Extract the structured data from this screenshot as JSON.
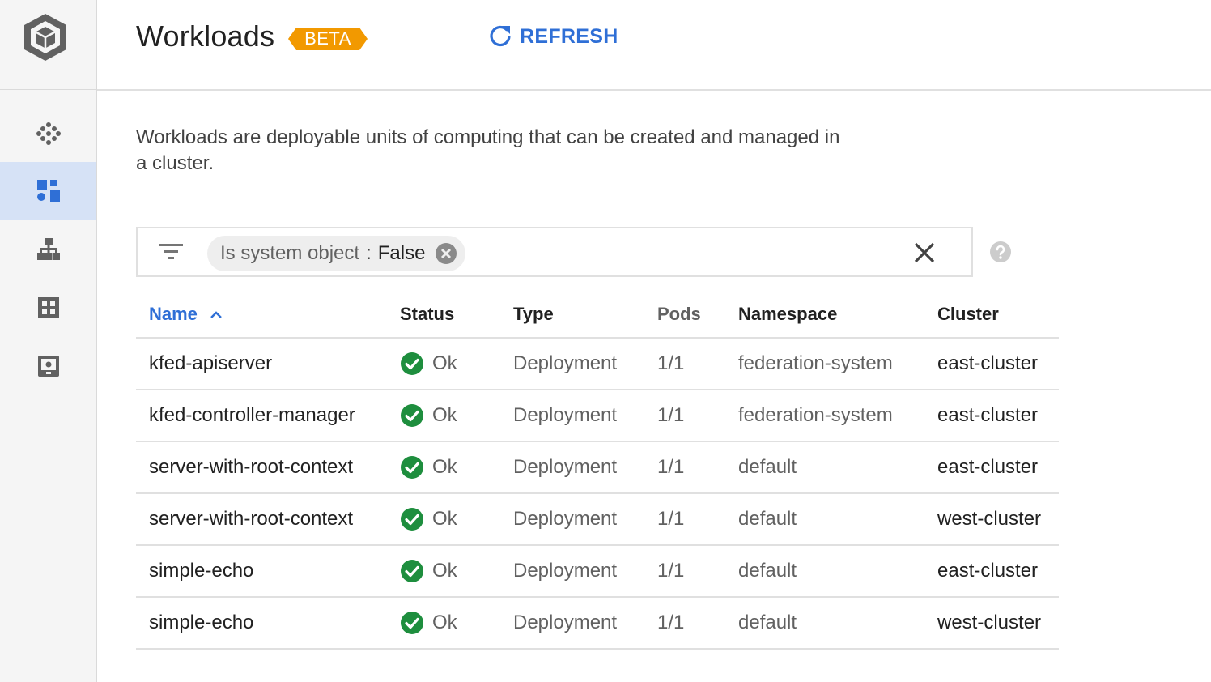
{
  "header": {
    "title": "Workloads",
    "badge": "BETA",
    "refresh_label": "REFRESH"
  },
  "sidebar": {
    "items": [
      {
        "icon": "clusters-icon",
        "active": false
      },
      {
        "icon": "workloads-icon",
        "active": true
      },
      {
        "icon": "services-icon",
        "active": false
      },
      {
        "icon": "applications-icon",
        "active": false
      },
      {
        "icon": "configuration-icon",
        "active": false
      }
    ]
  },
  "description": "Workloads are deployable units of computing that can be created and managed in a cluster.",
  "filter": {
    "chip_key": "Is system object",
    "chip_sep": ":",
    "chip_value": "False"
  },
  "table": {
    "columns": {
      "name": "Name",
      "status": "Status",
      "type": "Type",
      "pods": "Pods",
      "namespace": "Namespace",
      "cluster": "Cluster"
    },
    "rows": [
      {
        "name": "kfed-apiserver",
        "status": "Ok",
        "type": "Deployment",
        "pods": "1/1",
        "namespace": "federation-system",
        "cluster": "east-cluster"
      },
      {
        "name": "kfed-controller-manager",
        "status": "Ok",
        "type": "Deployment",
        "pods": "1/1",
        "namespace": "federation-system",
        "cluster": "east-cluster"
      },
      {
        "name": "server-with-root-context",
        "status": "Ok",
        "type": "Deployment",
        "pods": "1/1",
        "namespace": "default",
        "cluster": "east-cluster"
      },
      {
        "name": "server-with-root-context",
        "status": "Ok",
        "type": "Deployment",
        "pods": "1/1",
        "namespace": "default",
        "cluster": "west-cluster"
      },
      {
        "name": "simple-echo",
        "status": "Ok",
        "type": "Deployment",
        "pods": "1/1",
        "namespace": "default",
        "cluster": "east-cluster"
      },
      {
        "name": "simple-echo",
        "status": "Ok",
        "type": "Deployment",
        "pods": "1/1",
        "namespace": "default",
        "cluster": "west-cluster"
      }
    ]
  },
  "colors": {
    "accent": "#2f6fd6",
    "badge": "#f29900",
    "ok": "#1e8e3e",
    "sidebar_active": "#d6e2f6"
  }
}
